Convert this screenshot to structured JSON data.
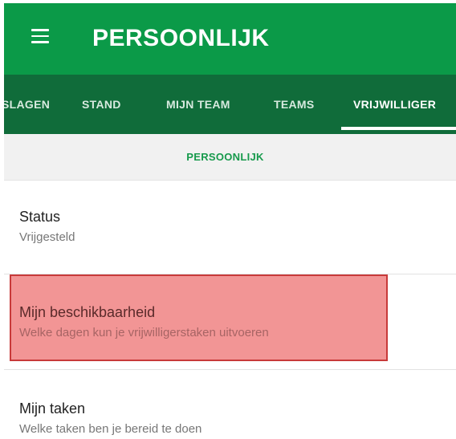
{
  "appbar": {
    "title": "PERSOONLIJK",
    "menu_icon": "hamburger-menu-icon",
    "color": "#0b9a48"
  },
  "tabs": [
    {
      "label": "SLAGEN",
      "active": false
    },
    {
      "label": "STAND",
      "active": false
    },
    {
      "label": "MIJN TEAM",
      "active": false
    },
    {
      "label": "TEAMS",
      "active": false
    },
    {
      "label": "VRIJWILLIGER",
      "active": true
    }
  ],
  "subheader": {
    "label": "PERSOONLIJK",
    "color": "#179a4c"
  },
  "items": [
    {
      "title": "Status",
      "subtitle": "Vrijgesteld"
    },
    {
      "title": "Mijn beschikbaarheid",
      "subtitle": "Welke dagen kun je vrijwilligerstaken uitvoeren",
      "highlighted": true
    },
    {
      "title": "Mijn taken",
      "subtitle": "Welke taken ben je bereid te doen"
    }
  ]
}
